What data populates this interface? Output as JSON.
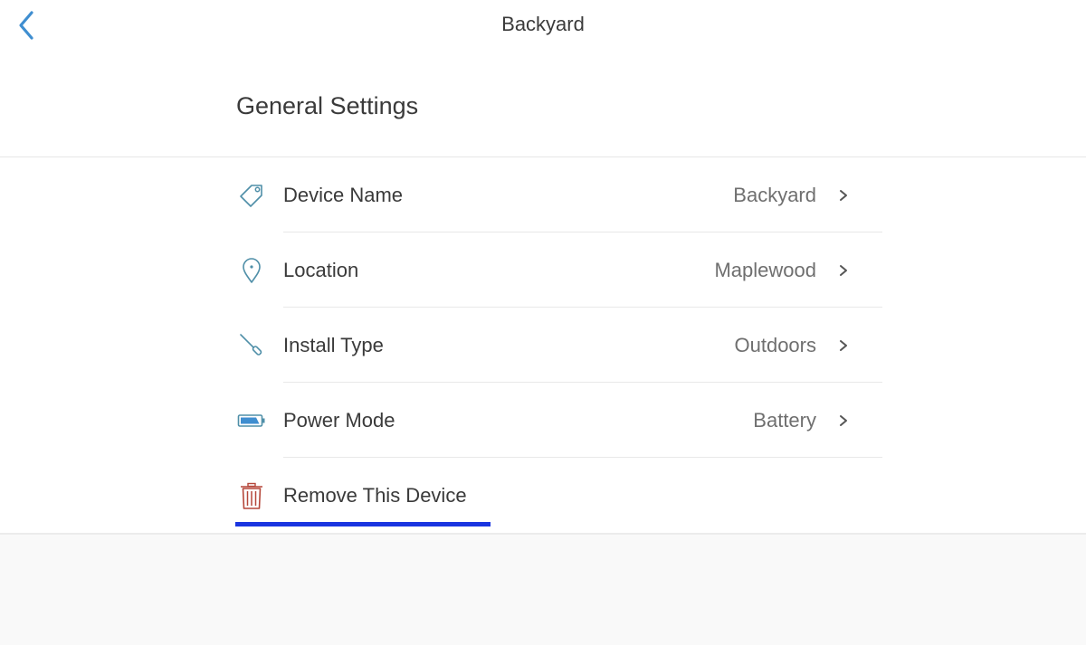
{
  "header": {
    "title": "Backyard",
    "back_icon": "chevron-left-icon"
  },
  "section": {
    "title": "General Settings"
  },
  "settings": [
    {
      "label": "Device Name",
      "value": "Backyard",
      "icon": "tag-icon"
    },
    {
      "label": "Location",
      "value": "Maplewood",
      "icon": "map-pin-icon"
    },
    {
      "label": "Install Type",
      "value": "Outdoors",
      "icon": "screwdriver-icon"
    },
    {
      "label": "Power Mode",
      "value": "Battery",
      "icon": "battery-icon"
    }
  ],
  "remove": {
    "label": "Remove This Device",
    "icon": "trash-icon"
  },
  "colors": {
    "accent": "#3f8ed0",
    "danger": "#b5473a",
    "highlight": "#1a35e0"
  }
}
